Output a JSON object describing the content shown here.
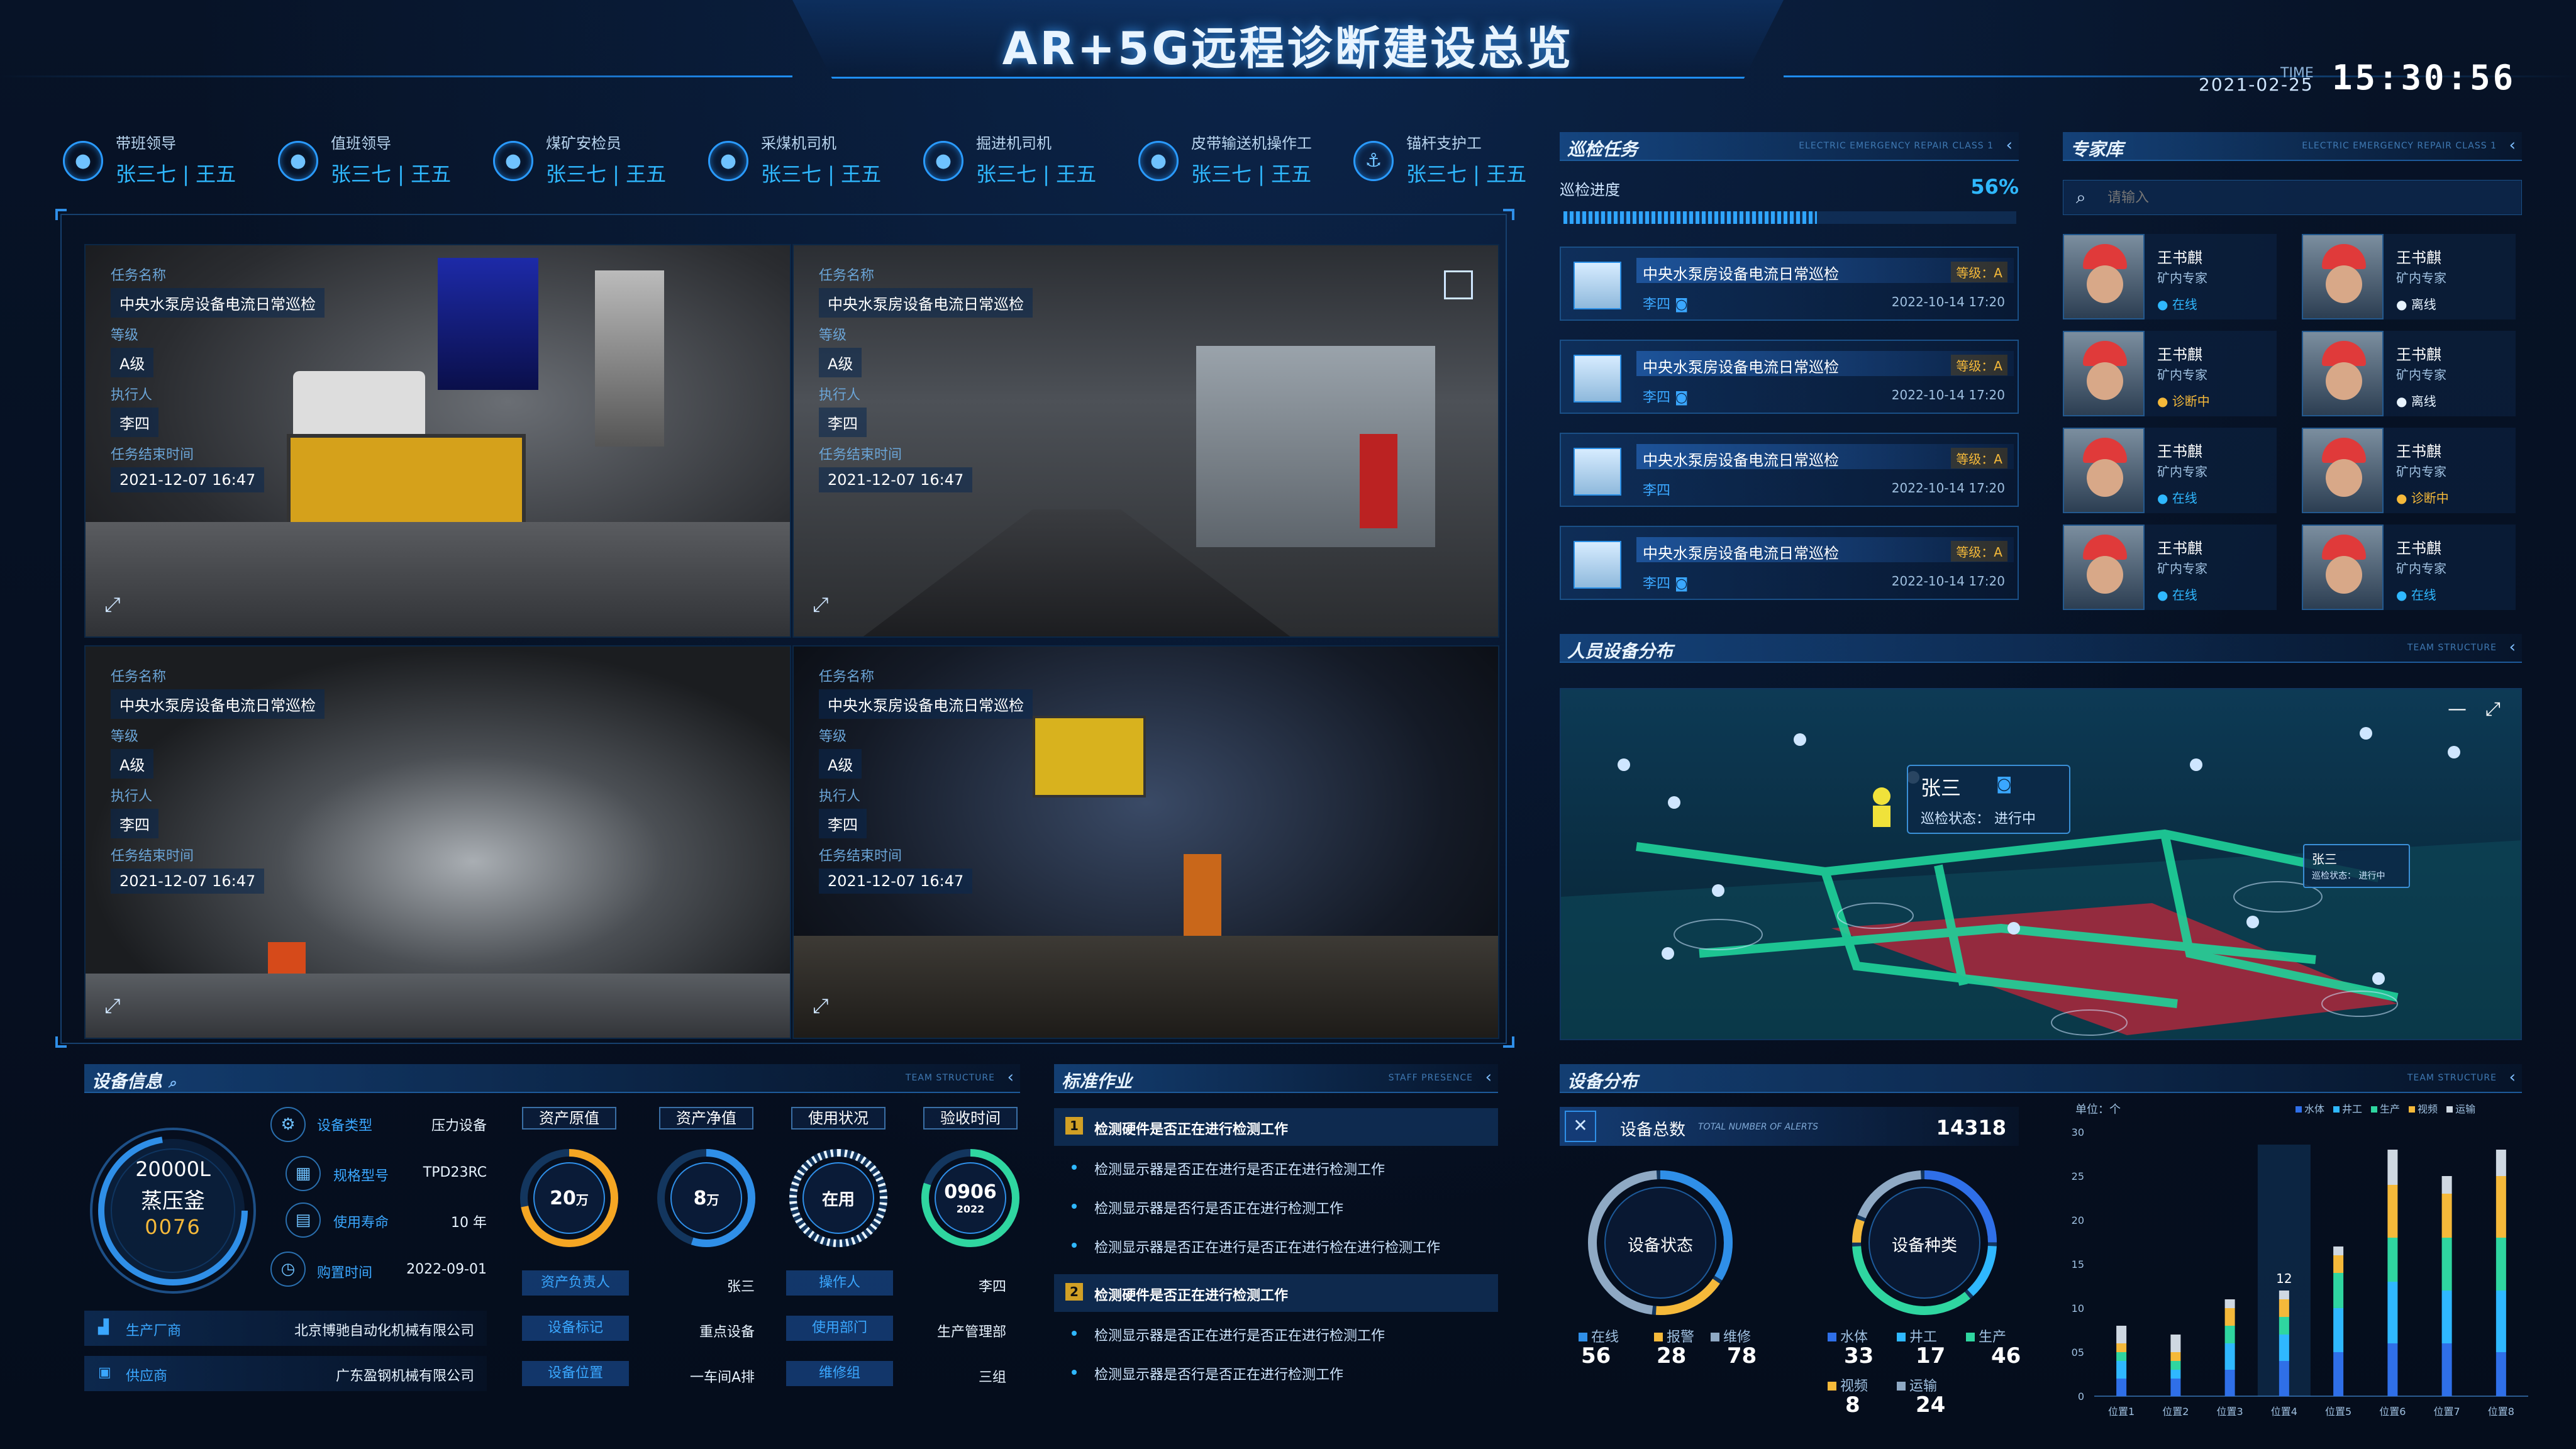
{
  "header": {
    "title": "AR+5G远程诊断建设总览",
    "time_label": "TIME",
    "date": "2021-02-25",
    "clock": "15:30:56"
  },
  "roles": [
    {
      "title": "带班领导",
      "value": "张三七 | 王五",
      "icon": "user-icon"
    },
    {
      "title": "值班领导",
      "value": "张三七 | 王五",
      "icon": "user-icon"
    },
    {
      "title": "煤矿安检员",
      "value": "张三七 | 王五",
      "icon": "user-icon"
    },
    {
      "title": "采煤机司机",
      "value": "张三七 | 王五",
      "icon": "user-icon"
    },
    {
      "title": "掘进机司机",
      "value": "张三七 | 王五",
      "icon": "user-icon"
    },
    {
      "title": "皮带输送机操作工",
      "value": "张三七 | 王五",
      "icon": "user-icon"
    },
    {
      "title": "锚杆支护工",
      "value": "张三七 | 王五",
      "icon": "anchor-icon"
    }
  ],
  "videos": [
    {
      "task_label": "任务名称",
      "task": "中央水泵房设备电流日常巡检",
      "level_label": "等级",
      "level": "A级",
      "exec_label": "执行人",
      "exec": "李四",
      "end_label": "任务结束时间",
      "end": "2021-12-07 16:47"
    },
    {
      "task_label": "任务名称",
      "task": "中央水泵房设备电流日常巡检",
      "level_label": "等级",
      "level": "A级",
      "exec_label": "执行人",
      "exec": "李四",
      "end_label": "任务结束时间",
      "end": "2021-12-07 16:47"
    },
    {
      "task_label": "任务名称",
      "task": "中央水泵房设备电流日常巡检",
      "level_label": "等级",
      "level": "A级",
      "exec_label": "执行人",
      "exec": "李四",
      "end_label": "任务结束时间",
      "end": "2021-12-07 16:47"
    },
    {
      "task_label": "任务名称",
      "task": "中央水泵房设备电流日常巡检",
      "level_label": "等级",
      "level": "A级",
      "exec_label": "执行人",
      "exec": "李四",
      "end_label": "任务结束时间",
      "end": "2021-12-07 16:47"
    }
  ],
  "inspection": {
    "title": "巡检任务",
    "subtitle": "ELECTRIC EMERGENCY REPAIR CLASS 1",
    "progress_label": "巡检进度",
    "progress_text": "56%",
    "progress": 0.56,
    "tasks": [
      {
        "name": "中央水泵房设备电流日常巡检",
        "level": "等级：A",
        "person": "李四",
        "time": "2022-10-14 17:20"
      },
      {
        "name": "中央水泵房设备电流日常巡检",
        "level": "等级：A",
        "person": "李四",
        "time": "2022-10-14 17:20"
      },
      {
        "name": "中央水泵房设备电流日常巡检",
        "level": "等级：A",
        "person": "李四",
        "time": "2022-10-14 17:20"
      },
      {
        "name": "中央水泵房设备电流日常巡检",
        "level": "等级：A",
        "person": "李四",
        "time": "2022-10-14 17:20"
      }
    ]
  },
  "experts": {
    "title": "专家库",
    "subtitle": "ELECTRIC EMERGENCY REPAIR CLASS 1",
    "search_placeholder": "请输入",
    "items": [
      {
        "name": "王书麒",
        "role": "矿内专家",
        "status": "在线",
        "color": "#2fb8ff"
      },
      {
        "name": "王书麒",
        "role": "矿内专家",
        "status": "离线",
        "color": "#e8f4ff"
      },
      {
        "name": "王书麒",
        "role": "矿内专家",
        "status": "诊断中",
        "color": "#f5b93a"
      },
      {
        "name": "王书麒",
        "role": "矿内专家",
        "status": "离线",
        "color": "#e8f4ff"
      },
      {
        "name": "王书麒",
        "role": "矿内专家",
        "status": "在线",
        "color": "#2fb8ff"
      },
      {
        "name": "王书麒",
        "role": "矿内专家",
        "status": "诊断中",
        "color": "#f5b93a"
      },
      {
        "name": "王书麒",
        "role": "矿内专家",
        "status": "在线",
        "color": "#2fb8ff"
      },
      {
        "name": "王书麒",
        "role": "矿内专家",
        "status": "在线",
        "color": "#2fb8ff"
      }
    ]
  },
  "distribution": {
    "title": "人员设备分布",
    "subtitle": "TEAM STRUCTURE",
    "popup_name": "张三",
    "popup_status_label": "巡检状态：",
    "popup_status": "进行中",
    "popup2_name": "张三",
    "popup2_status_label": "巡检状态：",
    "popup2_status": "进行中"
  },
  "device_info": {
    "title": "设备信息",
    "subtitle": "TEAM STRUCTURE",
    "gauge_line1": "20000L",
    "gauge_line2": "蒸压釜",
    "gauge_code": "0076",
    "rows": [
      {
        "label": "设备类型",
        "value": "压力设备"
      },
      {
        "label": "规格型号",
        "value": "TPD23RC"
      },
      {
        "label": "使用寿命",
        "value": "10 年"
      },
      {
        "label": "购置时间",
        "value": "2022-09-01"
      }
    ],
    "maker_label": "生产厂商",
    "maker": "北京博驰自动化机械有限公司",
    "supplier_label": "供应商",
    "supplier": "广东盈钢机械有限公司",
    "boxes": [
      {
        "title": "资产原值",
        "value": "20",
        "unit": "万",
        "fraction": 0.72,
        "color": "#f5a623"
      },
      {
        "title": "资产净值",
        "value": "8",
        "unit": "万",
        "fraction": 0.55,
        "color": "#2f8fe8"
      },
      {
        "title": "使用状况",
        "value": "在用",
        "unit": "",
        "fraction": 1.0,
        "color": "#e8f4ff"
      },
      {
        "title": "验收时间",
        "value": "0906",
        "unit": "2022",
        "fraction": 0.8,
        "color": "#2fd6a0"
      }
    ],
    "extra": [
      {
        "label": "资产负责人",
        "value": "张三",
        "label2": "操作人",
        "value2": "李四"
      },
      {
        "label": "设备标记",
        "value": "重点设备",
        "label2": "使用部门",
        "value2": "生产管理部"
      },
      {
        "label": "设备位置",
        "value": "一车间A排",
        "label2": "维修组",
        "value2": "三组"
      }
    ]
  },
  "standard": {
    "title": "标准作业",
    "subtitle": "STAFF PRESENCE",
    "items": [
      {
        "num": "1",
        "text": "检测硬件是否正在进行检测工作",
        "header": true
      },
      {
        "num": "",
        "text": "检测显示器是否正在进行是否正在进行检测工作",
        "header": false
      },
      {
        "num": "",
        "text": "检测显示器是否行是否正在进行检测工作",
        "header": false
      },
      {
        "num": "",
        "text": "检测显示器是否正在进行是否正在进行检在进行检测工作",
        "header": false
      },
      {
        "num": "2",
        "text": "检测硬件是否正在进行检测工作",
        "header": true
      },
      {
        "num": "",
        "text": "检测显示器是否正在进行是否正在进行检测工作",
        "header": false
      },
      {
        "num": "",
        "text": "检测显示器是否行是否正在进行检测工作",
        "header": false
      }
    ]
  },
  "device_dist": {
    "title": "设备分布",
    "subtitle": "TEAM STRUCTURE",
    "total_label": "设备总数",
    "total_sub": "TOTAL NUMBER OF ALERTS",
    "total": "14318",
    "ring1_label": "设备状态",
    "ring2_label": "设备种类",
    "legend1": [
      {
        "name": "在线",
        "value": "56",
        "color": "#2f8fe8"
      },
      {
        "name": "报警",
        "value": "28",
        "color": "#f5b93a"
      },
      {
        "name": "维修",
        "value": "78",
        "color": "#8fa9c4"
      }
    ],
    "legend2": [
      {
        "name": "水体",
        "value": "33",
        "color": "#2f6fe8"
      },
      {
        "name": "井工",
        "value": "17",
        "color": "#2fb8ff"
      },
      {
        "name": "生产",
        "value": "46",
        "color": "#2fd6a0"
      },
      {
        "name": "视频",
        "value": "8",
        "color": "#f5b93a"
      },
      {
        "name": "运输",
        "value": "24",
        "color": "#8fa9c4"
      }
    ]
  },
  "chart_data": {
    "type": "bar",
    "unit_label": "单位：个",
    "categories": [
      "位置1",
      "位置2",
      "位置3",
      "位置4",
      "位置5",
      "位置6",
      "位置7",
      "位置8"
    ],
    "ylim": [
      0,
      30
    ],
    "yticks": [
      "0",
      "05",
      "10",
      "15",
      "20",
      "25",
      "30"
    ],
    "highlight_index": 3,
    "highlight_label": "12",
    "series": [
      {
        "name": "水体",
        "color": "#2f6fe8",
        "values": [
          2,
          2,
          3,
          4,
          5,
          6,
          6,
          5
        ]
      },
      {
        "name": "井工",
        "color": "#2fb8ff",
        "values": [
          2,
          1,
          3,
          3,
          5,
          7,
          6,
          7
        ]
      },
      {
        "name": "生产",
        "color": "#2fd6a0",
        "values": [
          1,
          1,
          2,
          2,
          4,
          5,
          6,
          6
        ]
      },
      {
        "name": "视频",
        "color": "#f5b93a",
        "values": [
          1,
          1,
          2,
          2,
          2,
          6,
          5,
          7
        ]
      },
      {
        "name": "运输",
        "color": "#cfd8e2",
        "values": [
          2,
          2,
          1,
          1,
          1,
          4,
          2,
          3
        ]
      }
    ]
  }
}
